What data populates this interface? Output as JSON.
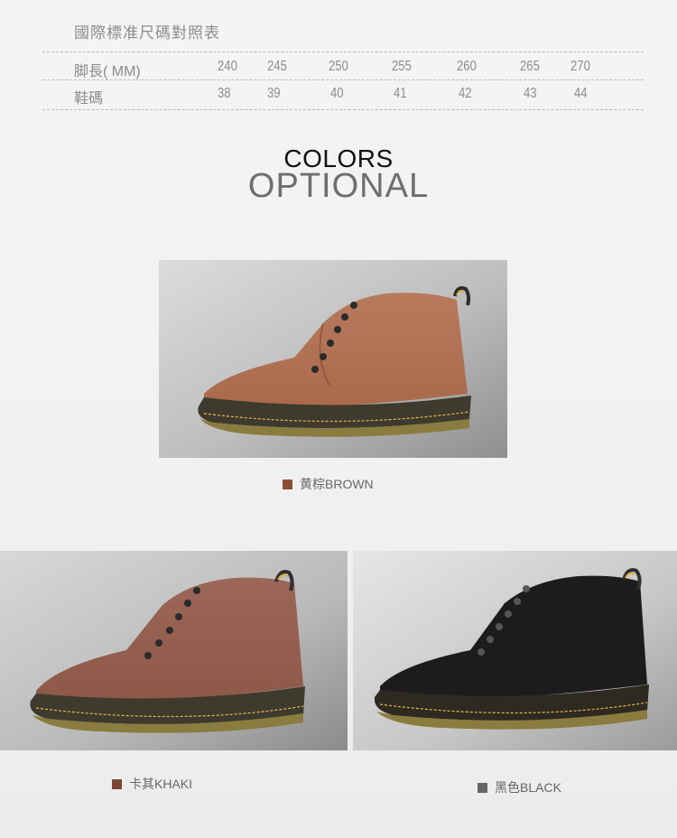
{
  "size_chart": {
    "title": "國際標准尺碼對照表",
    "rows": [
      {
        "label": "脚長( MM)",
        "values": [
          "240",
          "245",
          "250",
          "255",
          "260",
          "265",
          "270"
        ]
      },
      {
        "label": "鞋碼",
        "values": [
          "38",
          "39",
          "40",
          "41",
          "42",
          "43",
          "44"
        ]
      }
    ]
  },
  "heading": {
    "line1": "COLORS",
    "line2": "OPTIONAL"
  },
  "variants": [
    {
      "label": "黄棕BROWN",
      "swatch": "#8e4d35"
    },
    {
      "label": "卡其KHAKI",
      "swatch": "#7a4636"
    },
    {
      "label": "黑色BLACK",
      "swatch": "#666666"
    }
  ]
}
